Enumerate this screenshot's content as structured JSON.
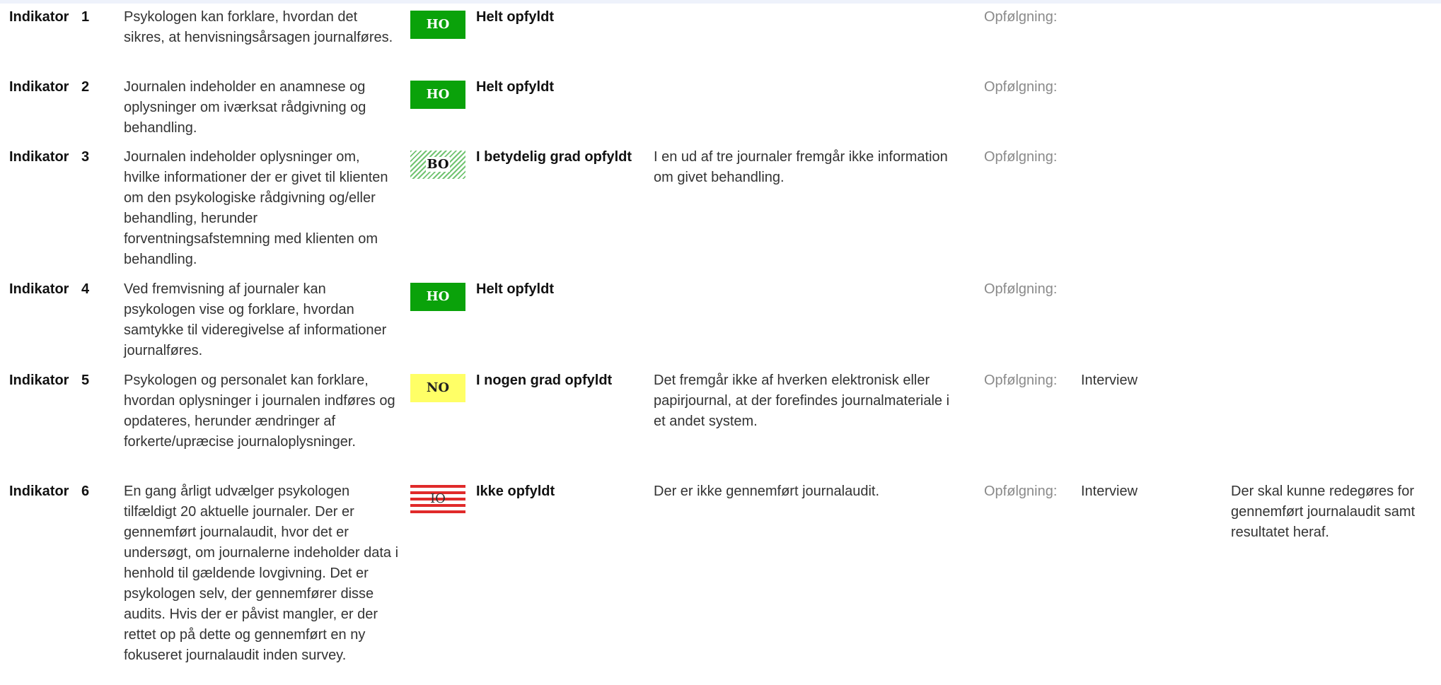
{
  "indicator_label": "Indikator",
  "followup_label": "Opfølgning:",
  "rows": [
    {
      "number": "1",
      "description": "Psykologen kan forklare, hvordan det sikres, at henvisningsårsagen journalføres.",
      "badge": "HO",
      "status": "Helt opfyldt",
      "note": "",
      "followup": "",
      "action": ""
    },
    {
      "number": "2",
      "description": "Journalen indeholder en anamnese og oplysninger om iværksat rådgivning og behandling.",
      "badge": "HO",
      "status": "Helt opfyldt",
      "note": "",
      "followup": "",
      "action": ""
    },
    {
      "number": "3",
      "description": "Journalen indeholder oplysninger om, hvilke informationer der er givet til klienten om den psykologiske rådgivning og/eller behandling, herunder forventningsafstemning med klienten om behandling.",
      "badge": "BO",
      "status": "I betydelig grad opfyldt",
      "note": "I en ud af tre journaler fremgår ikke information om givet behandling.",
      "followup": "",
      "action": ""
    },
    {
      "number": "4",
      "description": "Ved fremvisning af journaler kan psykologen vise og forklare, hvordan samtykke til videregivelse af informationer journalføres.",
      "badge": "HO",
      "status": "Helt opfyldt",
      "note": "",
      "followup": "",
      "action": ""
    },
    {
      "number": "5",
      "description": "Psykologen og personalet kan forklare, hvordan oplysninger i journalen indføres og opdateres, herunder ændringer af forkerte/upræcise journaloplysninger.",
      "badge": "NO",
      "status": "I nogen grad opfyldt",
      "note": "Det fremgår ikke af hverken elektronisk eller papirjournal, at der forefindes journalmateriale i et andet system.",
      "followup": "Interview",
      "action": ""
    },
    {
      "number": "6",
      "description": "En gang årligt udvælger psykologen tilfældigt 20 aktuelle journaler. Der er gennemført journalaudit, hvor det er undersøgt, om journalerne indeholder data i henhold til gældende lovgivning. Det er psykologen selv, der gennemfører disse audits. Hvis der er påvist mangler, er der rettet op på dette og gennemført en ny fokuseret journalaudit inden survey.",
      "badge": "IO",
      "status": "Ikke opfyldt",
      "note": "Der er ikke gennemført journalaudit.",
      "followup": "Interview",
      "action": "Der skal kunne redegøres for gennemført journalaudit samt resultatet heraf."
    }
  ]
}
